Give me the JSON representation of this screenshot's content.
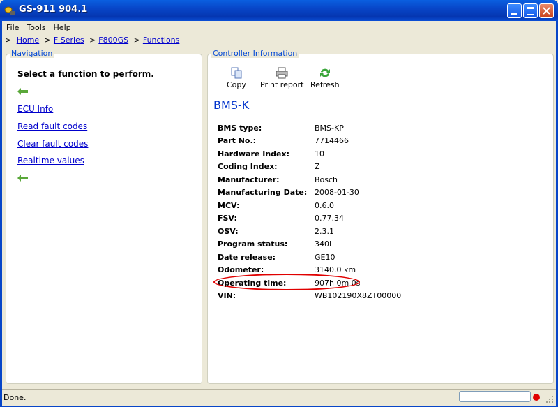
{
  "window": {
    "title": "GS-911 904.1"
  },
  "menu": {
    "items": [
      "File",
      "Tools",
      "Help"
    ]
  },
  "breadcrumb": {
    "prefix": ">",
    "items": [
      "Home",
      "F Series",
      "F800GS",
      "Functions"
    ]
  },
  "navigation": {
    "legend": "Navigation",
    "heading": "Select a function to perform.",
    "links": [
      "ECU Info",
      "Read fault codes",
      "Clear fault codes",
      "Realtime values"
    ]
  },
  "controller": {
    "legend": "Controller Information",
    "toolbar": {
      "copy": "Copy",
      "print": "Print report",
      "refresh": "Refresh"
    },
    "title": "BMS-K",
    "properties": [
      {
        "label": "BMS type:",
        "value": "BMS-KP"
      },
      {
        "label": "Part No.:",
        "value": "7714466"
      },
      {
        "label": "Hardware Index:",
        "value": "10"
      },
      {
        "label": "Coding Index:",
        "value": "Z"
      },
      {
        "label": "Manufacturer:",
        "value": "Bosch"
      },
      {
        "label": "Manufacturing Date:",
        "value": "2008-01-30"
      },
      {
        "label": "MCV:",
        "value": "0.6.0"
      },
      {
        "label": "FSV:",
        "value": "0.77.34"
      },
      {
        "label": "OSV:",
        "value": "2.3.1"
      },
      {
        "label": "Program status:",
        "value": "340I"
      },
      {
        "label": "Date release:",
        "value": "GE10"
      },
      {
        "label": "Odometer:",
        "value": "3140.0 km"
      },
      {
        "label": "Operating time:",
        "value": "907h 0m 0s"
      },
      {
        "label": "VIN:",
        "value": "WB102190X8ZT00000"
      }
    ]
  },
  "status": {
    "text": "Done.",
    "connection_color": "#e00000"
  },
  "colors": {
    "titlebar": "#0846c8",
    "link": "#0000cc",
    "legend": "#0046d5",
    "highlight": "#e00000"
  }
}
